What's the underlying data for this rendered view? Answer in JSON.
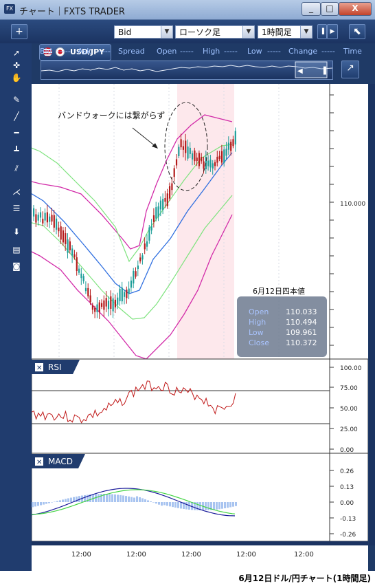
{
  "window": {
    "icon": "FX",
    "title": "チャート｜FXTS TRADER",
    "min_label": "_",
    "max_label": "□",
    "close_label": "X"
  },
  "toolbar": {
    "add_label": "+",
    "pair": "USD/JPY",
    "price_type": "Bid",
    "chart_type": "ローソク足",
    "timeframe": "1時間足",
    "expand_label": "⬉"
  },
  "quote_bar": {
    "bid_label": "Bid",
    "bid": "-----",
    "ask_label": "Ask",
    "ask": "-----",
    "spread_label": "Spread",
    "open_label": "Open",
    "open": "-----",
    "high_label": "High",
    "high": "-----",
    "low_label": "Low",
    "low": "-----",
    "change_label": "Change",
    "change": "-----",
    "time_label": "Time"
  },
  "tools": [
    "cursor-icon",
    "crosshair-icon",
    "hand-icon",
    "pen-icon",
    "trendline-icon",
    "horizontal-line-icon",
    "vertical-line-icon",
    "channel-icon",
    "fan-icon",
    "fibonacci-icon",
    "arrow-down-icon",
    "indicator-list-icon",
    "camera-icon"
  ],
  "main_chart": {
    "annotation": "バンドウォークには繋がらず",
    "price_label": "110.000",
    "info_box": {
      "title": "6月12日四本値",
      "rows": [
        {
          "label": "Open",
          "value": "110.033"
        },
        {
          "label": "High",
          "value": "110.494"
        },
        {
          "label": "Low",
          "value": "109.961"
        },
        {
          "label": "Close",
          "value": "110.372"
        }
      ]
    }
  },
  "rsi_panel": {
    "title": "RSI",
    "close_label": "✕",
    "ticks": [
      "100.00",
      "75.00",
      "50.00",
      "25.00",
      "0.00"
    ]
  },
  "macd_panel": {
    "title": "MACD",
    "close_label": "✕",
    "ticks": [
      "0.26",
      "0.13",
      "0.00",
      "-0.13",
      "-0.26"
    ]
  },
  "x_axis": [
    "12:00",
    "12:00",
    "12:00",
    "12:00",
    "12:00"
  ],
  "caption": "6月12日ドル/円チャート(1時間足)",
  "colors": {
    "upper_band": "#d22aa8",
    "mid_band": "#7ee37e",
    "sma": "#2f6fe0",
    "candle_up": "#1d9e99",
    "candle_down": "#b41b1b",
    "rsi": "#c01818",
    "macd": "#1a1a9a",
    "signal": "#44d444",
    "histogram": "#a8c4f0",
    "highlight": "#fde8ec"
  }
}
